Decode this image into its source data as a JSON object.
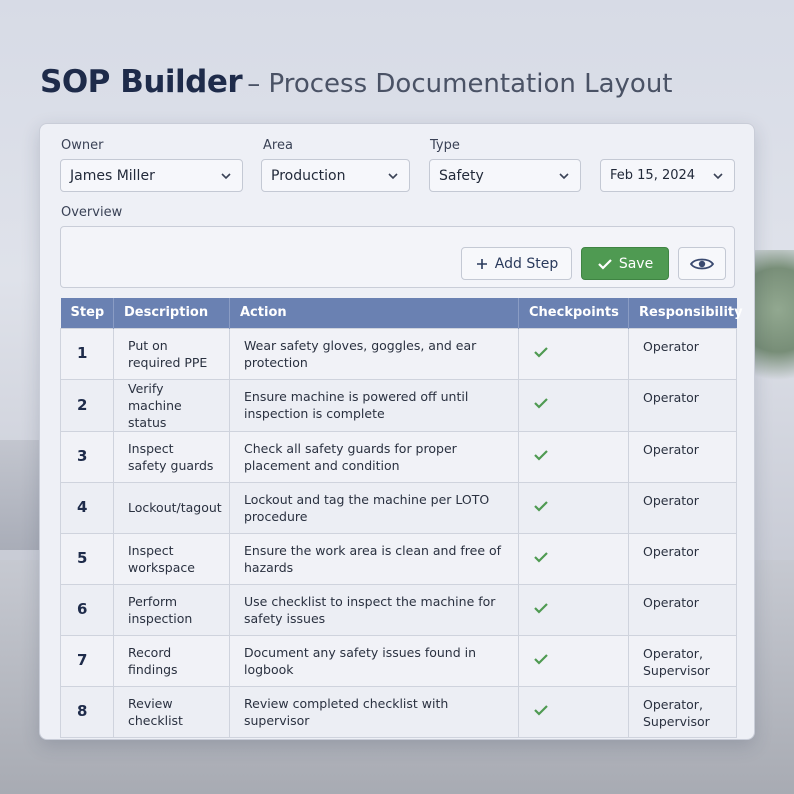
{
  "header": {
    "title": "SOP Builder",
    "subtitle": "– Process Documentation Layout"
  },
  "form": {
    "owner": {
      "label": "Owner",
      "value": "James Miller"
    },
    "area": {
      "label": "Area",
      "value": "Production"
    },
    "type": {
      "label": "Type",
      "value": "Safety"
    },
    "date": {
      "value": "Feb 15, 2024"
    },
    "overview": {
      "label": "Overview",
      "value": ""
    }
  },
  "toolbar": {
    "add_step_label": "Add Step",
    "save_label": "Save",
    "preview_icon": "eye-icon"
  },
  "table": {
    "columns": [
      "Step",
      "Description",
      "Action",
      "Checkpoints",
      "Responsibility"
    ],
    "rows": [
      {
        "step": "1",
        "description": "Put on required PPE",
        "action": "Wear safety gloves, goggles, and ear protection",
        "checkpoint": true,
        "responsibility": "Operator"
      },
      {
        "step": "2",
        "description": "Verify machine status",
        "action": "Ensure machine is powered off until inspection is complete",
        "checkpoint": true,
        "responsibility": "Operator"
      },
      {
        "step": "3",
        "description": "Inspect safety guards",
        "action": "Check all safety guards for proper placement and condition",
        "checkpoint": true,
        "responsibility": "Operator"
      },
      {
        "step": "4",
        "description": "Lockout/tagout",
        "action": "Lockout and tag the machine per LOTO procedure",
        "checkpoint": true,
        "responsibility": "Operator"
      },
      {
        "step": "5",
        "description": "Inspect workspace",
        "action": "Ensure the work area is clean and free of hazards",
        "checkpoint": true,
        "responsibility": "Operator"
      },
      {
        "step": "6",
        "description": "Perform inspection",
        "action": "Use checklist to inspect the machine for safety issues",
        "checkpoint": true,
        "responsibility": "Operator"
      },
      {
        "step": "7",
        "description": "Record findings",
        "action": "Document any safety issues found in logbook",
        "checkpoint": true,
        "responsibility": "Operator, Supervisor"
      },
      {
        "step": "8",
        "description": "Review checklist",
        "action": "Review completed checklist with supervisor",
        "checkpoint": true,
        "responsibility": "Operator, Supervisor"
      }
    ]
  },
  "colors": {
    "header_bg": "#6a81b2",
    "save_bg": "#4f9a52",
    "check": "#4f9a52",
    "title": "#1e2b4a"
  }
}
